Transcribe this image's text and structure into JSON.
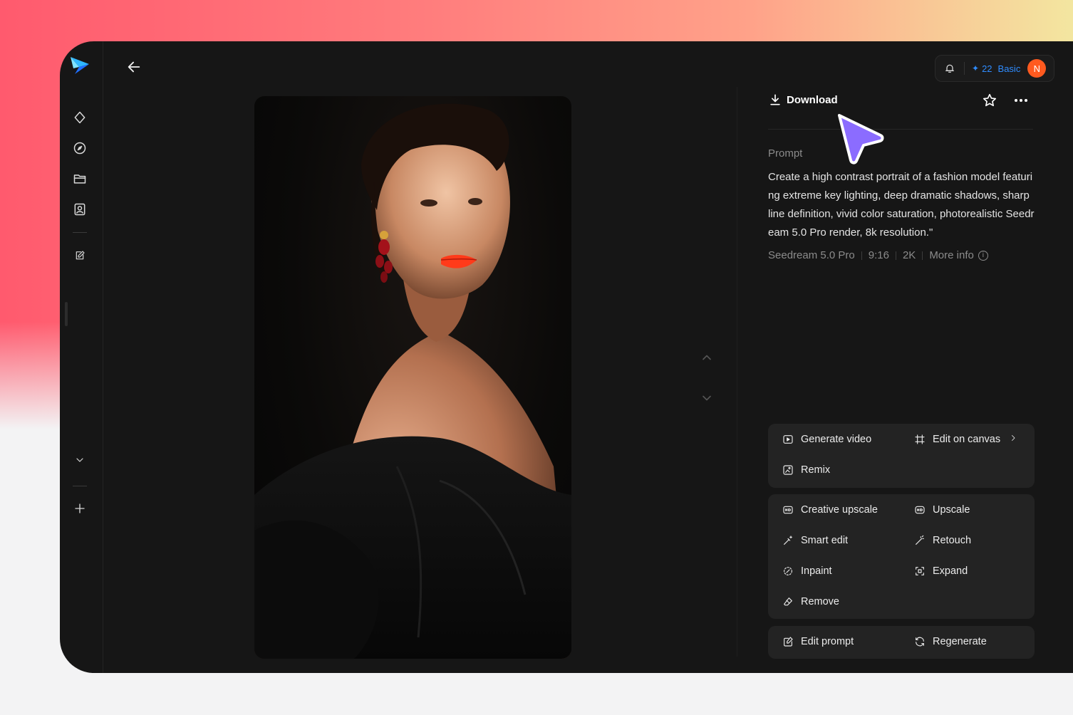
{
  "header": {
    "credits": "22",
    "plan": "Basic",
    "avatar_initial": "N"
  },
  "detail": {
    "download_label": "Download",
    "prompt_label": "Prompt",
    "prompt_text": "Create a high contrast portrait of a fashion model featuring extreme key lighting, deep dramatic shadows, sharp line definition, vivid color saturation, photorealistic Seedream 5.0 Pro render, 8k resolution.\"",
    "meta": {
      "model": "Seedream 5.0 Pro",
      "ratio": "9:16",
      "resolution": "2K",
      "more_info": "More info"
    }
  },
  "actions": {
    "generate_video": "Generate video",
    "edit_on_canvas": "Edit on canvas",
    "remix": "Remix",
    "creative_upscale": "Creative upscale",
    "upscale": "Upscale",
    "smart_edit": "Smart edit",
    "retouch": "Retouch",
    "inpaint": "Inpaint",
    "expand": "Expand",
    "remove": "Remove",
    "edit_prompt": "Edit prompt",
    "regenerate": "Regenerate"
  },
  "colors": {
    "accent": "#2f8cff",
    "avatar": "#ff5a1f",
    "cursor": "#8b6cff",
    "panel": "#161616",
    "card": "#232323"
  }
}
